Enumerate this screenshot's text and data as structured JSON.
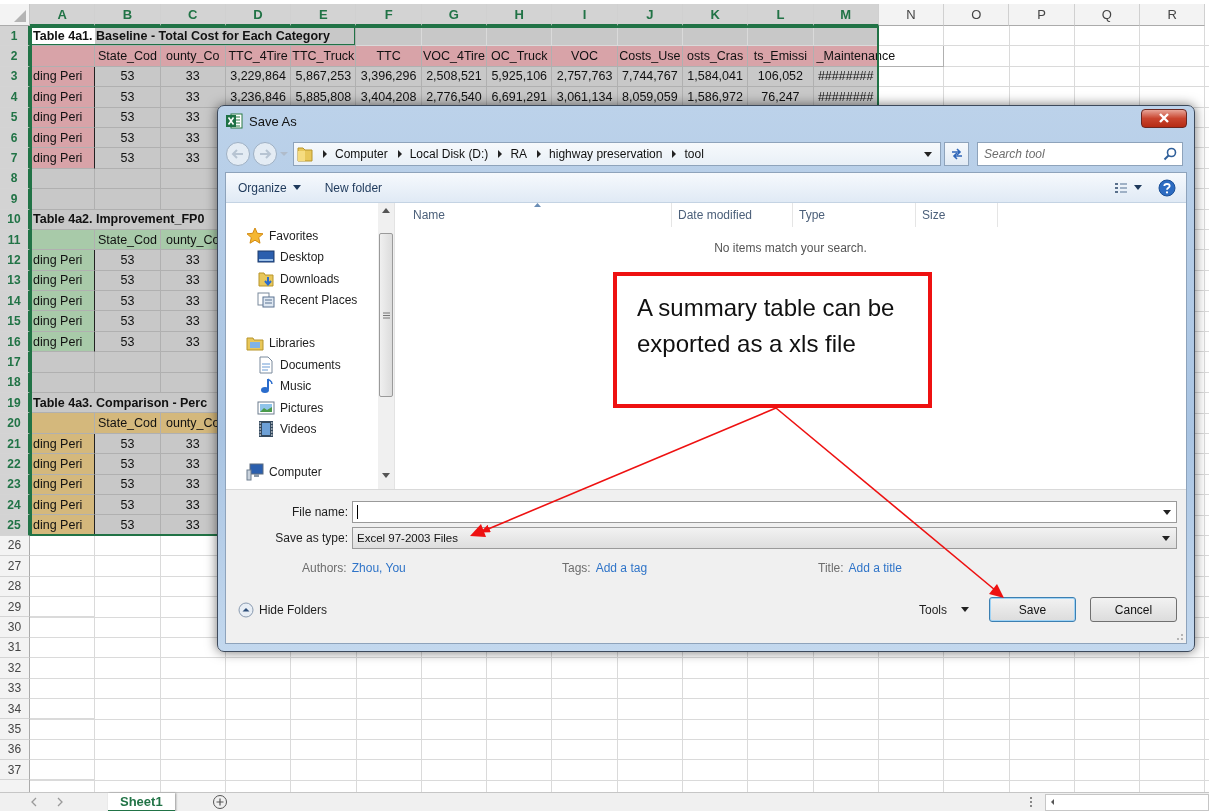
{
  "sheet": {
    "columns": [
      {
        "label": "A",
        "selected": true
      },
      {
        "label": "B",
        "selected": true
      },
      {
        "label": "C",
        "selected": true
      },
      {
        "label": "D",
        "selected": true
      },
      {
        "label": "E",
        "selected": true
      },
      {
        "label": "F",
        "selected": true
      },
      {
        "label": "G",
        "selected": true
      },
      {
        "label": "H",
        "selected": true
      },
      {
        "label": "I",
        "selected": true
      },
      {
        "label": "J",
        "selected": true
      },
      {
        "label": "K",
        "selected": true
      },
      {
        "label": "L",
        "selected": true
      },
      {
        "label": "M",
        "selected": true
      },
      {
        "label": "N",
        "selected": false
      },
      {
        "label": "O",
        "selected": false
      },
      {
        "label": "P",
        "selected": false
      },
      {
        "label": "Q",
        "selected": false
      },
      {
        "label": "R",
        "selected": false
      }
    ],
    "rows": [
      {
        "number": "1",
        "selected": true,
        "active": true,
        "kind": "title",
        "cells": [
          "Table 4a1. Baseline - Total Cost for Each Category"
        ]
      },
      {
        "number": "2",
        "selected": true,
        "active": false,
        "kind": "header",
        "color": "#d8a3a8",
        "cells": [
          "",
          "State_Cod",
          "ounty_Co",
          "TTC_4Tire",
          "TTC_Truck",
          "TTC",
          "VOC_4Tire",
          "OC_Truck",
          "VOC",
          "Costs_Use",
          "osts_Cras",
          "ts_Emissi",
          "_Maintenance"
        ]
      },
      {
        "number": "3",
        "selected": true,
        "active": false,
        "kind": "data",
        "color": "#d8a3a8",
        "cells": [
          "ding Peri",
          "53",
          "33",
          "3,229,864",
          "5,867,253",
          "3,396,296",
          "2,508,521",
          "5,925,106",
          "2,757,763",
          "7,744,767",
          "1,584,041",
          "106,052",
          "########"
        ]
      },
      {
        "number": "4",
        "selected": true,
        "active": false,
        "kind": "data",
        "color": "#d8a3a8",
        "cells": [
          "ding Peri",
          "53",
          "33",
          "3,236,846",
          "5,885,808",
          "3,404,208",
          "2,776,540",
          "6,691,291",
          "3,061,134",
          "8,059,059",
          "1,586,972",
          "76,247",
          "########"
        ]
      },
      {
        "number": "5",
        "selected": true,
        "active": false,
        "kind": "data",
        "color": "#d8a3a8",
        "cells": [
          "ding Peri",
          "53",
          "33"
        ]
      },
      {
        "number": "6",
        "selected": true,
        "active": false,
        "kind": "data",
        "color": "#d8a3a8",
        "cells": [
          "ding Peri",
          "53",
          "33"
        ]
      },
      {
        "number": "7",
        "selected": true,
        "active": false,
        "kind": "data",
        "color": "#d8a3a8",
        "cells": [
          "ding Peri",
          "53",
          "33"
        ]
      },
      {
        "number": "8",
        "selected": true,
        "active": false,
        "kind": "gap",
        "cells": []
      },
      {
        "number": "9",
        "selected": true,
        "active": false,
        "kind": "gap",
        "cells": []
      },
      {
        "number": "10",
        "selected": true,
        "active": false,
        "kind": "title",
        "cells": [
          "Table 4a2. Improvement_FP0"
        ]
      },
      {
        "number": "11",
        "selected": true,
        "active": false,
        "kind": "header",
        "color": "#a8caa9",
        "cells": [
          "",
          "State_Cod",
          "ounty_Co"
        ]
      },
      {
        "number": "12",
        "selected": true,
        "active": false,
        "kind": "data",
        "color": "#a8caa9",
        "cells": [
          "ding Peri",
          "53",
          "33"
        ]
      },
      {
        "number": "13",
        "selected": true,
        "active": false,
        "kind": "data",
        "color": "#a8caa9",
        "cells": [
          "ding Peri",
          "53",
          "33"
        ]
      },
      {
        "number": "14",
        "selected": true,
        "active": false,
        "kind": "data",
        "color": "#a8caa9",
        "cells": [
          "ding Peri",
          "53",
          "33"
        ]
      },
      {
        "number": "15",
        "selected": true,
        "active": false,
        "kind": "data",
        "color": "#a8caa9",
        "cells": [
          "ding Peri",
          "53",
          "33"
        ]
      },
      {
        "number": "16",
        "selected": true,
        "active": false,
        "kind": "data",
        "color": "#a8caa9",
        "cells": [
          "ding Peri",
          "53",
          "33"
        ]
      },
      {
        "number": "17",
        "selected": true,
        "active": false,
        "kind": "gap",
        "cells": []
      },
      {
        "number": "18",
        "selected": true,
        "active": false,
        "kind": "gap",
        "cells": []
      },
      {
        "number": "19",
        "selected": true,
        "active": false,
        "kind": "title",
        "cells": [
          "Table 4a3. Comparison - Perc"
        ]
      },
      {
        "number": "20",
        "selected": true,
        "active": false,
        "kind": "header",
        "color": "#d4b87c",
        "cells": [
          "",
          "State_Cod",
          "ounty_Co"
        ]
      },
      {
        "number": "21",
        "selected": true,
        "active": false,
        "kind": "data",
        "color": "#d4b87c",
        "cells": [
          "ding Peri",
          "53",
          "33"
        ]
      },
      {
        "number": "22",
        "selected": true,
        "active": false,
        "kind": "data",
        "color": "#d4b87c",
        "cells": [
          "ding Peri",
          "53",
          "33"
        ]
      },
      {
        "number": "23",
        "selected": true,
        "active": false,
        "kind": "data",
        "color": "#d4b87c",
        "cells": [
          "ding Peri",
          "53",
          "33"
        ]
      },
      {
        "number": "24",
        "selected": true,
        "active": false,
        "kind": "data",
        "color": "#d4b87c",
        "cells": [
          "ding Peri",
          "53",
          "33"
        ]
      },
      {
        "number": "25",
        "selected": true,
        "active": false,
        "kind": "data",
        "color": "#d4b87c",
        "cells": [
          "ding Peri",
          "53",
          "33"
        ]
      },
      {
        "number": "26",
        "selected": false,
        "active": false,
        "kind": "empty",
        "cells": []
      },
      {
        "number": "27",
        "selected": false,
        "active": false,
        "kind": "empty",
        "cells": []
      },
      {
        "number": "28",
        "selected": false,
        "active": false,
        "kind": "empty",
        "cells": []
      },
      {
        "number": "29",
        "selected": false,
        "active": false,
        "kind": "empty",
        "cells": []
      },
      {
        "number": "30",
        "selected": false,
        "active": false,
        "kind": "empty",
        "cells": []
      },
      {
        "number": "31",
        "selected": false,
        "active": false,
        "kind": "empty",
        "cells": []
      },
      {
        "number": "32",
        "selected": false,
        "active": false,
        "kind": "empty",
        "cells": []
      },
      {
        "number": "33",
        "selected": false,
        "active": false,
        "kind": "empty",
        "cells": []
      },
      {
        "number": "34",
        "selected": false,
        "active": false,
        "kind": "empty",
        "cells": []
      },
      {
        "number": "35",
        "selected": false,
        "active": false,
        "kind": "empty",
        "cells": []
      },
      {
        "number": "36",
        "selected": false,
        "active": false,
        "kind": "empty",
        "cells": []
      },
      {
        "number": "37",
        "selected": false,
        "active": false,
        "kind": "empty",
        "cells": []
      }
    ]
  },
  "sheet_tabs": [
    {
      "label": "Sheet1",
      "selected": true
    }
  ],
  "dialog": {
    "title": "Save As",
    "breadcrumb": [
      "Computer",
      "Local Disk (D:)",
      "RA",
      "highway preservation",
      "tool"
    ],
    "search": {
      "placeholder": "Search tool"
    },
    "toolbar": [
      {
        "label": "Organize",
        "kind": "menu"
      },
      {
        "label": "New folder",
        "kind": "button"
      }
    ],
    "navigation": [
      {
        "label": "Favorites",
        "kind": "favorites",
        "children": [
          {
            "label": "Desktop",
            "kind": "desktop"
          },
          {
            "label": "Downloads",
            "kind": "downloads"
          },
          {
            "label": "Recent Places",
            "kind": "recent"
          }
        ]
      },
      {
        "label": "Libraries",
        "kind": "libraries",
        "children": [
          {
            "label": "Documents",
            "kind": "documents"
          },
          {
            "label": "Music",
            "kind": "music"
          },
          {
            "label": "Pictures",
            "kind": "pictures"
          },
          {
            "label": "Videos",
            "kind": "videos"
          }
        ]
      },
      {
        "label": "Computer",
        "kind": "computer"
      }
    ],
    "file_columns": [
      "Name",
      "Date modified",
      "Type",
      "Size"
    ],
    "empty_message": "No items match your search.",
    "file_name": {
      "label": "File name:"
    },
    "save_as_type": {
      "label": "Save as type:",
      "value": "Excel 97-2003 Files"
    },
    "properties": [
      {
        "label": "Authors:",
        "value": "Zhou, You"
      },
      {
        "label": "Tags:",
        "value": "Add a tag"
      },
      {
        "label": "Title:",
        "value": "Add a title"
      }
    ],
    "hide_folders": "Hide Folders",
    "tools": "Tools",
    "buttons": [
      {
        "label": "Save",
        "default": true
      },
      {
        "label": "Cancel",
        "default": false
      }
    ]
  },
  "callout": {
    "text": "A summary table can be exported as a xls file"
  }
}
